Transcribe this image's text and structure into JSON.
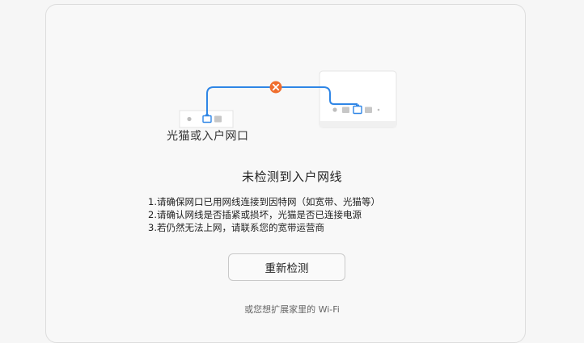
{
  "modem_label": "光猫或入户网口",
  "title": "未检测到入户网线",
  "tips": [
    "1.请确保网口已用网线连接到因特网（如宽带、光猫等）",
    "2.请确认网线是否插紧或损坏，光猫是否已连接电源",
    "3.若仍然无法上网，请联系您的宽带运营商"
  ],
  "recheck_button": "重新检测",
  "extend_link": "或您想扩展家里的 Wi-Fi",
  "icons": {
    "disconnect": "error-x-icon",
    "cable": "network-cable-line",
    "modem": "modem-device",
    "router": "router-device"
  },
  "colors": {
    "cable": "#2f86e6",
    "error": "#f06e2d",
    "port_highlight": "#2f86e6"
  }
}
